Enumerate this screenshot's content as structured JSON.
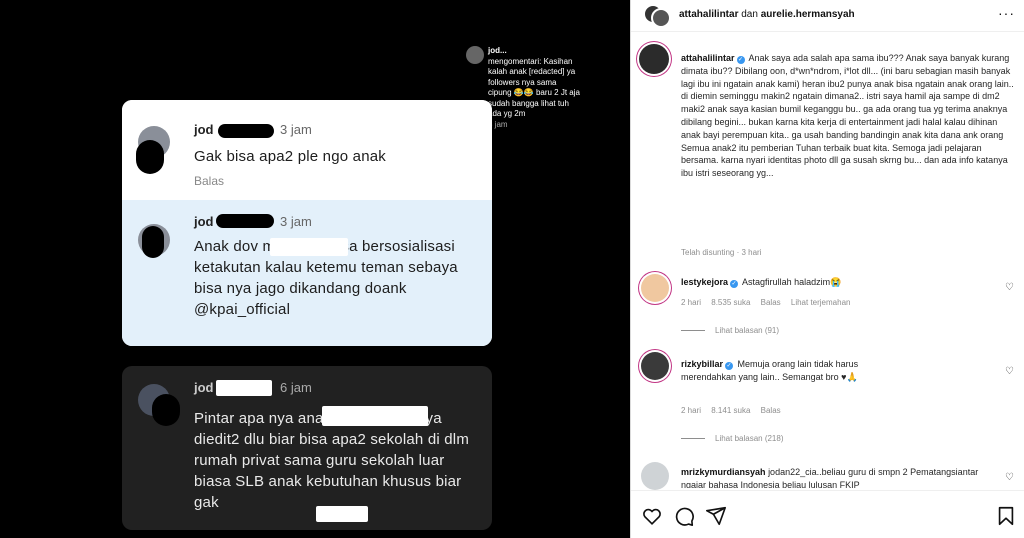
{
  "media": {
    "tooltip": {
      "name": "jod...",
      "text": "mengomentari: Kasihan kalah anak [redacted] ya followers nya sama cipung 😂😂 baru 2 Jt aja sudah bangga lihat tuh ada yg 2m",
      "time": "5 jam"
    },
    "comments": [
      {
        "name": "jod",
        "time": "3 jam",
        "text": "Gak bisa apa2 ple        ngo anak",
        "reply": "Balas"
      },
      {
        "name": "jod",
        "time": "3 jam",
        "text": "Anak dov            m yg gak bisa bersosialisasi ketakutan kalau ketemu teman sebaya bisa nya jago dikandang doank @kpai_official"
      },
      {
        "name": "jod",
        "time": "6 jam",
        "text": "Pintar apa nya anak d              om suara nya diedit2 dlu biar bisa apa2 sekolah di dlm rumah privat sama guru sekolah luar biasa SLB anak kebutuhan khusus biar gak"
      }
    ]
  },
  "header": {
    "user1": "attahalilintar",
    "joiner": "dan",
    "user2": "aurelie.hermansyah",
    "more": "···"
  },
  "caption": {
    "username": "attahalilintar",
    "text": "Anak saya ada salah apa sama ibu??? Anak saya banyak kurang dimata ibu?? Dibilang oon, d*wn*ndrom, i*lot dll... (ini baru sebagian masih banyak lagi ibu ini ngatain anak kami) heran ibu2 punya anak bisa ngatain anak orang lain.. di diemin seminggu makin2 ngatain dimana2.. istri saya hamil aja sampe di dm2 maki2 anak saya kasian bumil keganggu bu.. ga ada orang tua yg terima anaknya dibilang begini... bukan karna kita kerja di entertainment jadi halal kalau dihinan anak bayi perempuan kita.. ga usah banding bandingin anak kita dana ank orang Semua anak2 itu pemberian Tuhan terbaik buat kita. Semoga jadi pelajaran bersama. karna nyari identitas photo dll ga susah skrng bu... dan ada info katanya ibu istri seseorang yg...",
    "meta": "Telah disunting · 3 hari"
  },
  "comments": [
    {
      "username": "lestykejora",
      "verified": true,
      "text": "Astagfirullah haladzim😭",
      "time": "2 hari",
      "likes": "8.535 suka",
      "reply": "Balas",
      "translate": "Lihat terjemahan",
      "replies": "Lihat balasan (91)"
    },
    {
      "username": "rizkybillar",
      "verified": true,
      "text": "Memuja orang lain tidak harus merendahkan yang lain.. Semangat bro ♥🙏",
      "time": "2 hari",
      "likes": "8.141 suka",
      "reply": "Balas",
      "replies": "Lihat balasan (218)"
    },
    {
      "username": "mrizkymurdiansyah",
      "verified": false,
      "text": "jodan22_cia..beliau guru di smpn 2 Pematangsiantar ngajar bahasa Indonesia beliau lulusan FKIP"
    }
  ],
  "colors": {
    "verified": "#3897f0",
    "story_ring": "#c13584",
    "panel_border": "#dbdbdb"
  },
  "icons": [
    "heart-icon",
    "comment-icon",
    "share-icon",
    "bookmark-icon",
    "more-icon",
    "verified-icon"
  ]
}
